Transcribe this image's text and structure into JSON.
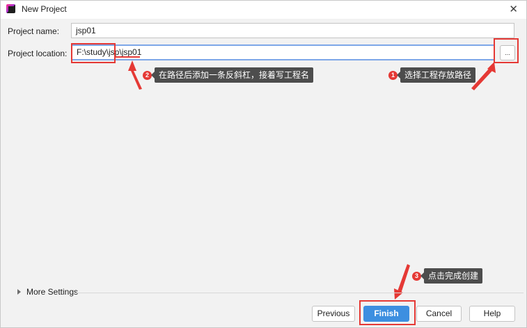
{
  "window": {
    "title": "New Project",
    "close_symbol": "✕"
  },
  "form": {
    "project_name_label": "Project name:",
    "project_name_value": "jsp01",
    "project_location_label": "Project location:",
    "project_location_base": "F:\\study\\jsp",
    "project_location_suffix": "\\jsp01",
    "browse_label": "..."
  },
  "annotations": [
    {
      "number": "1",
      "text": "选择工程存放路径"
    },
    {
      "number": "2",
      "text": "在路径后添加一条反斜杠，接着写工程名"
    },
    {
      "number": "3",
      "text": "点击完成创建"
    }
  ],
  "more_settings_label": "More Settings",
  "buttons": {
    "previous": "Previous",
    "finish": "Finish",
    "cancel": "Cancel",
    "help": "Help"
  },
  "colors": {
    "annotation_red": "#e53935",
    "primary_button": "#3d8fe0",
    "focus_border": "#7da7e8"
  },
  "icons": {
    "app": "intellij-app-icon",
    "close": "close-icon",
    "expand": "triangle-right-icon"
  }
}
